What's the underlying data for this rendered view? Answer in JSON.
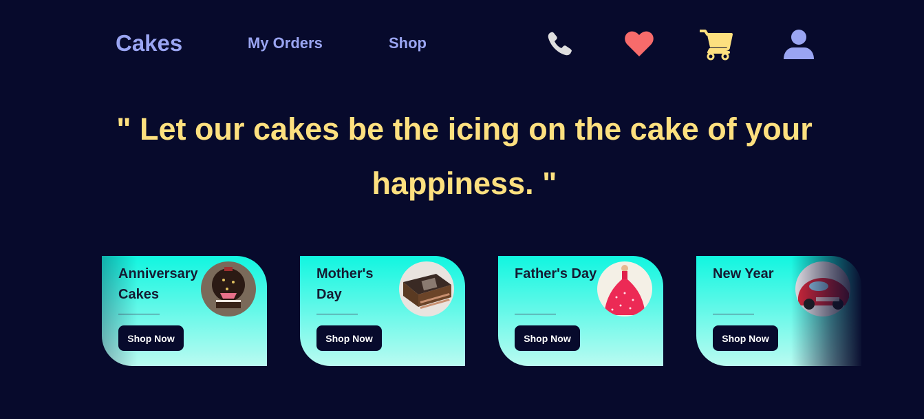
{
  "header": {
    "brand": "Cakes",
    "nav": {
      "my_orders": "My Orders",
      "shop": "Shop"
    },
    "icons": [
      "phone-icon",
      "heart-icon",
      "cart-icon",
      "user-icon"
    ],
    "colors": {
      "brand": "#9aa5f2",
      "phone": "#dedede",
      "heart": "#f76b6b",
      "cart": "#fde07f",
      "user": "#9aa5f2"
    }
  },
  "hero": {
    "quote": "\" Let our cakes be the icing on the cake of your happiness. \""
  },
  "categories": [
    {
      "title": "Anniversary Cakes",
      "button": "Shop Now",
      "image": "chocolate-anniversary-cake"
    },
    {
      "title": "Mother's Day",
      "button": "Shop Now",
      "image": "chocolate-slice-cake"
    },
    {
      "title": "Father's Day",
      "button": "Shop Now",
      "image": "doll-dress-cake"
    },
    {
      "title": "New Year",
      "button": "Shop Now",
      "image": "red-car-cake"
    }
  ],
  "theme": {
    "background": "#070a2c",
    "accent": "#fde07f",
    "card_gradient": [
      "#11f6e0",
      "#bafbf1"
    ]
  }
}
